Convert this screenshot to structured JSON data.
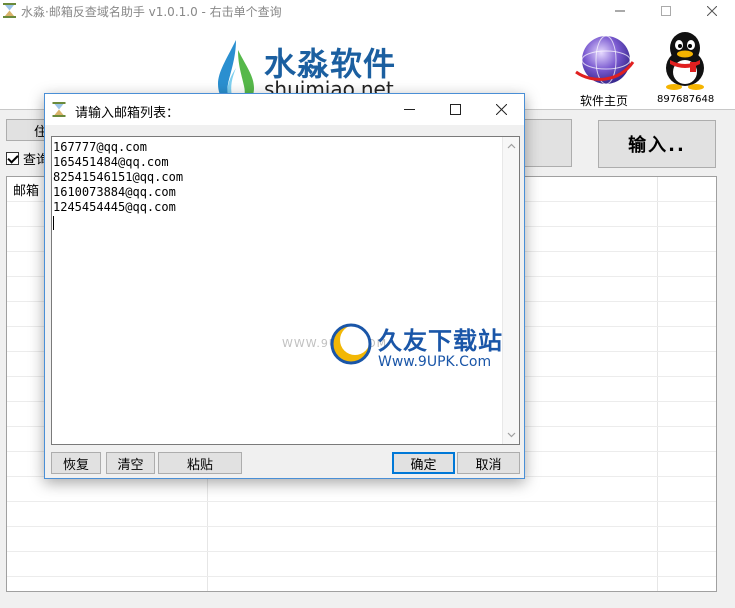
{
  "app": {
    "title": "水淼·邮箱反查域名助手 v1.0.1.0 - 右击单个查询"
  },
  "header": {
    "logo_cn": "水淼软件",
    "logo_en": "shuimiao.net",
    "homepage_label": "软件主页",
    "qq_label": "897687648"
  },
  "toolbar": {
    "partial_button_label": "住",
    "input_button_label": "输入..",
    "check_label": "查询",
    "check_checked": true
  },
  "grid": {
    "first_column_header": "邮箱"
  },
  "dialog": {
    "title": "请输入邮箱列表：",
    "emails": [
      "167777@qq.com",
      "165451484@qq.com",
      "82541546151@qq.com",
      "1610073884@qq.com",
      "1245454445@qq.com"
    ],
    "buttons": {
      "restore": "恢复",
      "clear": "清空",
      "paste": "粘贴",
      "ok": "确定",
      "cancel": "取消"
    }
  },
  "watermark": {
    "site": "WWW.9UPK.COM",
    "title": "久友下载站",
    "url": "Www.9UPK.Com"
  },
  "colors": {
    "logo_blue": "#1b5fa0",
    "accent": "#0078d7",
    "dialog_border": "#4a8fd6"
  }
}
